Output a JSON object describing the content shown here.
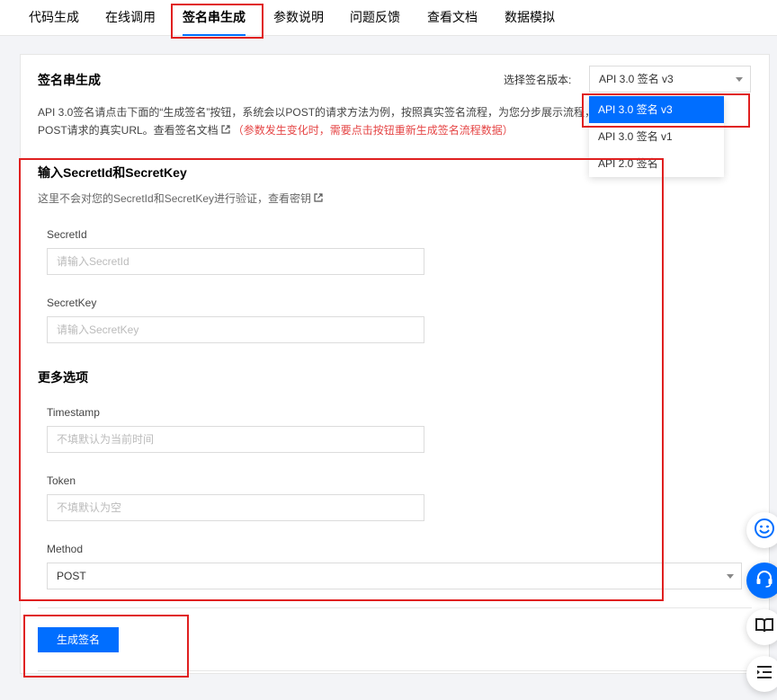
{
  "tabs": [
    {
      "label": "代码生成"
    },
    {
      "label": "在线调用"
    },
    {
      "label": "签名串生成"
    },
    {
      "label": "参数说明"
    },
    {
      "label": "问题反馈"
    },
    {
      "label": "查看文档"
    },
    {
      "label": "数据模拟"
    }
  ],
  "active_tab": "签名串生成",
  "panel": {
    "title": "签名串生成",
    "version_label": "选择签名版本:",
    "version_selected": "API 3.0 签名 v3",
    "version_options": [
      "API 3.0 签名 v3",
      "API 3.0 签名 v1",
      "API 2.0 签名"
    ],
    "desc_line1": "API 3.0签名请点击下面的“生成签名”按钮，系统会以POST的请求方法为例，按照真实签名流程，为您分步展示流程，",
    "desc_line2": "POST请求的真实URL。查看签名文档",
    "desc_note": "（参数发生变化时，需要点击按钮重新生成签名流程数据）"
  },
  "credentials": {
    "section_title": "输入SecretId和SecretKey",
    "hint": "这里不会对您的SecretId和SecretKey进行验证，查看密钥",
    "secret_id_label": "SecretId",
    "secret_id_placeholder": "请输入SecretId",
    "secret_key_label": "SecretKey",
    "secret_key_placeholder": "请输入SecretKey"
  },
  "options": {
    "section_title": "更多选项",
    "timestamp_label": "Timestamp",
    "timestamp_placeholder": "不填默认为当前时间",
    "token_label": "Token",
    "token_placeholder": "不填默认为空",
    "method_label": "Method",
    "method_value": "POST"
  },
  "generate_button": "生成签名",
  "colors": {
    "accent": "#006eff",
    "highlight_box": "#e02020",
    "note_red": "#e54545"
  }
}
